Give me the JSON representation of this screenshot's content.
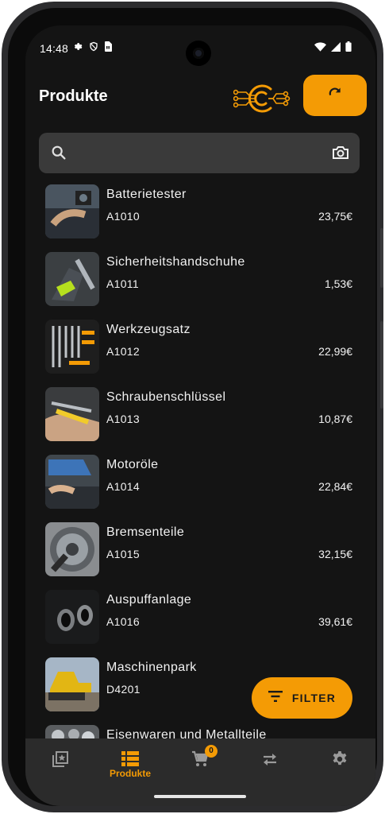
{
  "status": {
    "time": "14:48"
  },
  "header": {
    "title": "Produkte"
  },
  "search": {
    "placeholder": ""
  },
  "products": [
    {
      "name": "Batterietester",
      "code": "A1010",
      "price": "23,75€",
      "image": "battery-tester-photo"
    },
    {
      "name": "Sicherheitshandschuhe",
      "code": "A1011",
      "price": "1,53€",
      "image": "safety-gloves-photo"
    },
    {
      "name": "Werkzeugsatz",
      "code": "A1012",
      "price": "22,99€",
      "image": "tool-set-photo"
    },
    {
      "name": "Schraubenschlüssel",
      "code": "A1013",
      "price": "10,87€",
      "image": "wrenches-photo"
    },
    {
      "name": "Motoröle",
      "code": "A1014",
      "price": "22,84€",
      "image": "motor-oil-photo"
    },
    {
      "name": "Bremsenteile",
      "code": "A1015",
      "price": "32,15€",
      "image": "brake-parts-photo"
    },
    {
      "name": "Auspuffanlage",
      "code": "A1016",
      "price": "39,61€",
      "image": "exhaust-photo"
    },
    {
      "name": "Maschinenpark",
      "code": "D4201",
      "price": "",
      "image": "machinery-photo"
    },
    {
      "name": "Eisenwaren und Metallteile",
      "code": "",
      "price": "",
      "image": "hardware-photo"
    }
  ],
  "fab": {
    "label": "FILTER"
  },
  "nav": {
    "items": [
      {
        "icon": "favorites-icon",
        "label": ""
      },
      {
        "icon": "list-icon",
        "label": "Produkte"
      },
      {
        "icon": "cart-icon",
        "label": ""
      },
      {
        "icon": "swap-icon",
        "label": ""
      },
      {
        "icon": "gear-icon",
        "label": ""
      }
    ],
    "cart_badge": "0"
  },
  "colors": {
    "accent": "#f49b05",
    "background": "#141414",
    "nav": "#2b2b2b",
    "search": "#3a3a3a"
  }
}
